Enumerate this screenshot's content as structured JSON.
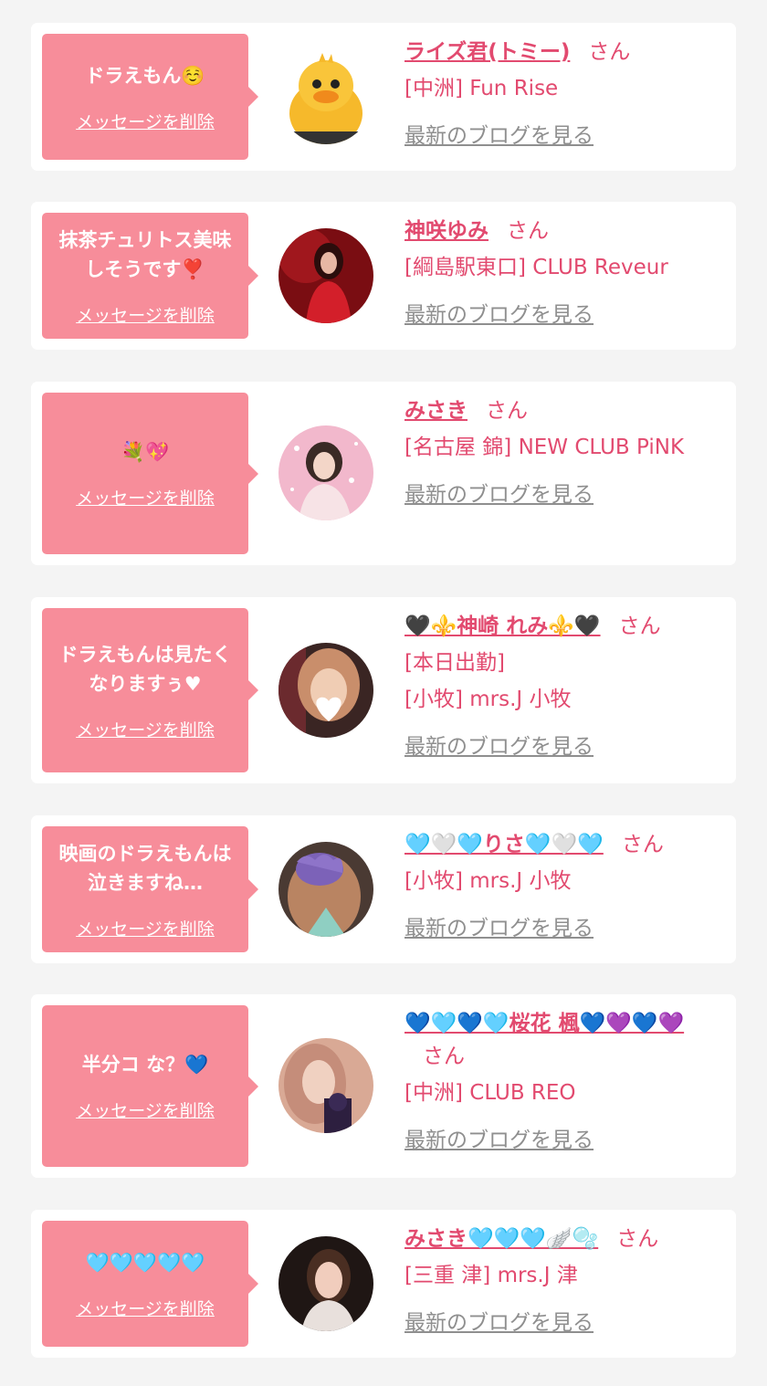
{
  "ui": {
    "delete_label": "メッセージを削除",
    "san_label": "さん",
    "blog_label": "最新のブログを見る"
  },
  "colors": {
    "background": "#f4f4f4",
    "bubble": "#f78d9a",
    "accent": "#e24a6f",
    "link_gray": "#8f8f8f"
  },
  "entries": [
    {
      "message": "ドラえもん☺️",
      "name": "ライズ君(トミー)",
      "shop": [
        "[中洲] Fun Rise"
      ],
      "avatar_icon": "duck-avatar"
    },
    {
      "message": "抹茶チュリトス美味しそうです❣️",
      "name": "神咲ゆみ",
      "shop": [
        "[綱島駅東口] CLUB Reveur"
      ],
      "avatar_icon": "woman-red-dress-avatar"
    },
    {
      "message": "💐💖",
      "name": "みさき",
      "shop": [
        "[名古屋 錦] NEW CLUB PiNK"
      ],
      "avatar_icon": "woman-pink-avatar"
    },
    {
      "message": "ドラえもんは見たくなりますぅ♥",
      "name": "🖤⚜️神崎 れみ⚜️🖤",
      "shop": [
        "[本日出勤]",
        "[小牧] mrs.J 小牧"
      ],
      "avatar_icon": "woman-heart-face-avatar"
    },
    {
      "message": "映画のドラえもんは泣きますね…",
      "name": "🩵🤍🩵りさ🩵🤍🩵",
      "shop": [
        "[小牧] mrs.J 小牧"
      ],
      "avatar_icon": "woman-purple-sticker-avatar"
    },
    {
      "message": "半分コ な？💙",
      "name": "💙🩵💙🩵桜花 楓💙💜💙💜",
      "shop": [
        "[中洲] CLUB REO"
      ],
      "avatar_icon": "woman-sticker-avatar"
    },
    {
      "message": "🩵🩵🩵🩵🩵",
      "name": "みさき🩵🩵🩵🪽🫧",
      "shop": [
        "[三重 津] mrs.J 津"
      ],
      "avatar_icon": "woman-dark-avatar"
    }
  ]
}
